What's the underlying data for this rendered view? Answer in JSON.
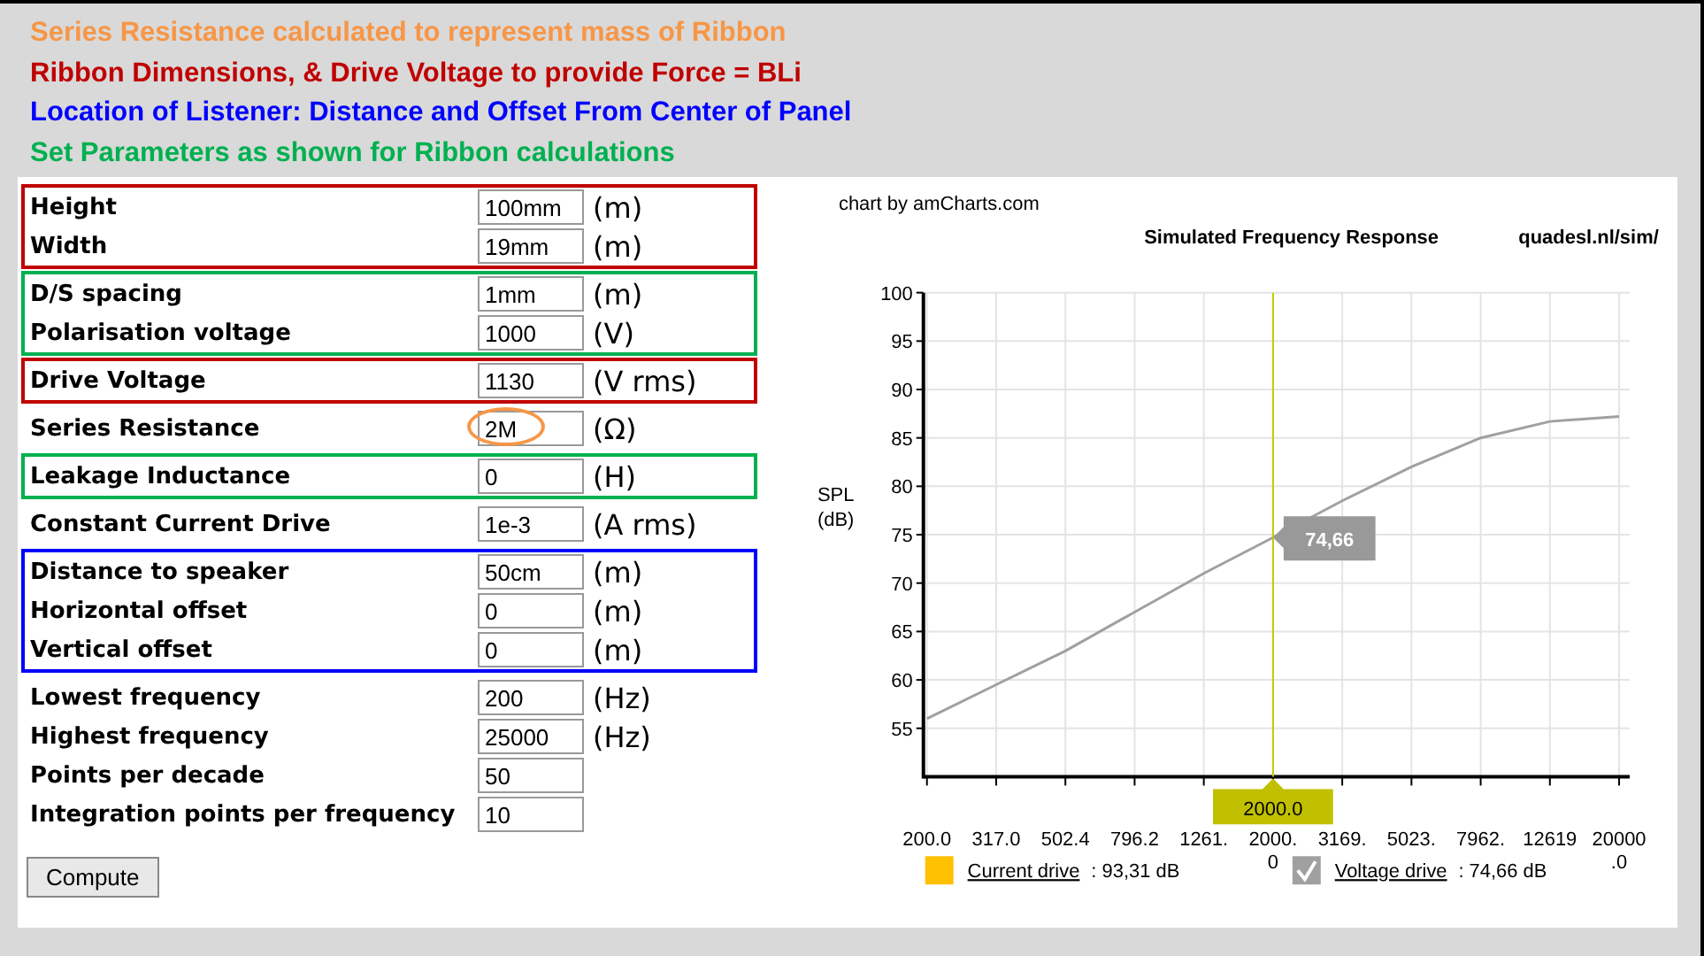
{
  "notes": [
    {
      "text": "Series Resistance calculated to represent mass of Ribbon",
      "color": "#f79646"
    },
    {
      "text": "Ribbon Dimensions, & Drive Voltage to provide Force = BLi",
      "color": "#c00000"
    },
    {
      "text": "Location of Listener: Distance and Offset From Center of Panel",
      "color": "#0000ff"
    },
    {
      "text": "Set Parameters as shown for Ribbon calculations",
      "color": "#00b050"
    }
  ],
  "form": {
    "groups": [
      {
        "color": "#c00000",
        "rows": [
          {
            "label": "Height",
            "value": "100mm",
            "unit": "(m)",
            "highlighted": false
          },
          {
            "label": "Width",
            "value": "19mm",
            "unit": "(m)",
            "highlighted": false
          }
        ]
      },
      {
        "color": "#00b050",
        "rows": [
          {
            "label": "D/S spacing",
            "value": "1mm",
            "unit": "(m)",
            "highlighted": false
          },
          {
            "label": "Polarisation voltage",
            "value": "1000",
            "unit": "(V)",
            "highlighted": false
          }
        ]
      },
      {
        "color": "#c00000",
        "rows": [
          {
            "label": "Drive Voltage",
            "value": "1130",
            "unit": "(V rms)",
            "highlighted": false
          }
        ]
      },
      {
        "rows": [
          {
            "label": "Series Resistance",
            "value": "2M",
            "unit": "(Ω)",
            "highlighted": true
          }
        ]
      },
      {
        "color": "#00b050",
        "rows": [
          {
            "label": "Leakage Inductance",
            "value": "0",
            "unit": "(H)",
            "highlighted": false
          }
        ]
      },
      {
        "rows": [
          {
            "label": "Constant Current Drive",
            "value": "1e-3",
            "unit": "(A rms)",
            "highlighted": false
          }
        ]
      },
      {
        "color": "#0000ff",
        "rows": [
          {
            "label": "Distance to speaker",
            "value": "50cm",
            "unit": "(m)",
            "highlighted": false
          },
          {
            "label": "Horizontal offset",
            "value": "0",
            "unit": "(m)",
            "highlighted": false
          },
          {
            "label": "Vertical offset",
            "value": "0",
            "unit": "(m)",
            "highlighted": false
          }
        ]
      },
      {
        "rows": [
          {
            "label": "Lowest frequency",
            "value": "200",
            "unit": "(Hz)",
            "highlighted": false
          },
          {
            "label": "Highest frequency",
            "value": "25000",
            "unit": "(Hz)",
            "highlighted": false
          },
          {
            "label": "Points per decade",
            "value": "50",
            "highlighted": false
          },
          {
            "label": "Integration points per frequency",
            "value": "10",
            "highlighted": false
          }
        ]
      }
    ],
    "button": "Compute"
  },
  "chart": {
    "credit": "chart by amCharts.com",
    "site": "quadesl.nl/sim/",
    "cursor": {
      "value_label": "74,66"
    },
    "legend": [
      {
        "label": "Current drive",
        "reading": ": 93,31 dB",
        "color": "#ffc000",
        "checked": false
      },
      {
        "reading": ": 74,66 dB",
        "checked": true
      }
    ],
    "chart_data": {
      "type": "line",
      "title": "Simulated Frequency Response",
      "ylabel": "SPL (dB)",
      "categories": [
        "200.0",
        "317.0",
        "502.4",
        "796.2",
        "1261.",
        "2000.0",
        "3169.",
        "5023.",
        "7962.",
        "12619",
        "20000.0"
      ],
      "series": [
        {
          "name": "Voltage drive",
          "color": "#a0a0a0",
          "values": [
            56,
            59.5,
            63,
            67,
            71,
            74.7,
            78.5,
            82,
            85,
            86.7,
            87.2
          ]
        }
      ],
      "ylim": [
        50,
        100
      ],
      "yticks": [
        55,
        60,
        65,
        70,
        75,
        80,
        85,
        90,
        95,
        100
      ],
      "grid": true,
      "ref_lines": [
        {
          "axis": "x",
          "value": "2000.0",
          "label": "2000.0"
        }
      ]
    }
  }
}
